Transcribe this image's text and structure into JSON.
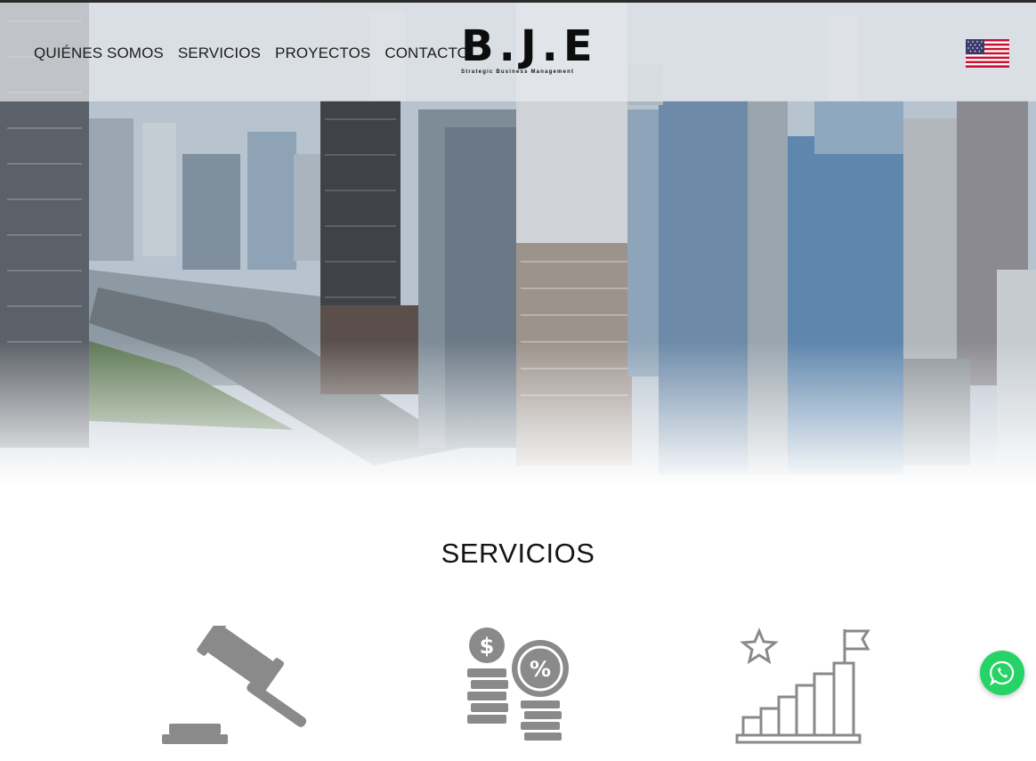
{
  "nav": {
    "items": [
      {
        "label": "QUIÉNES SOMOS"
      },
      {
        "label": "SERVICIOS"
      },
      {
        "label": "PROYECTOS"
      },
      {
        "label": "CONTACTO"
      }
    ]
  },
  "logo": {
    "text": "B.J.E",
    "tagline": "Strategic Business Management"
  },
  "language": {
    "flag_icon": "us-flag-icon"
  },
  "services": {
    "title": "SERVICIOS",
    "icons": [
      "gavel-icon",
      "coins-percent-icon",
      "growth-chart-flag-icon"
    ]
  },
  "whatsapp": {
    "icon": "whatsapp-icon",
    "color": "#25d366"
  },
  "colors": {
    "accent": "#25d366",
    "text": "#141414",
    "icon_gray": "#8a8a8a"
  }
}
